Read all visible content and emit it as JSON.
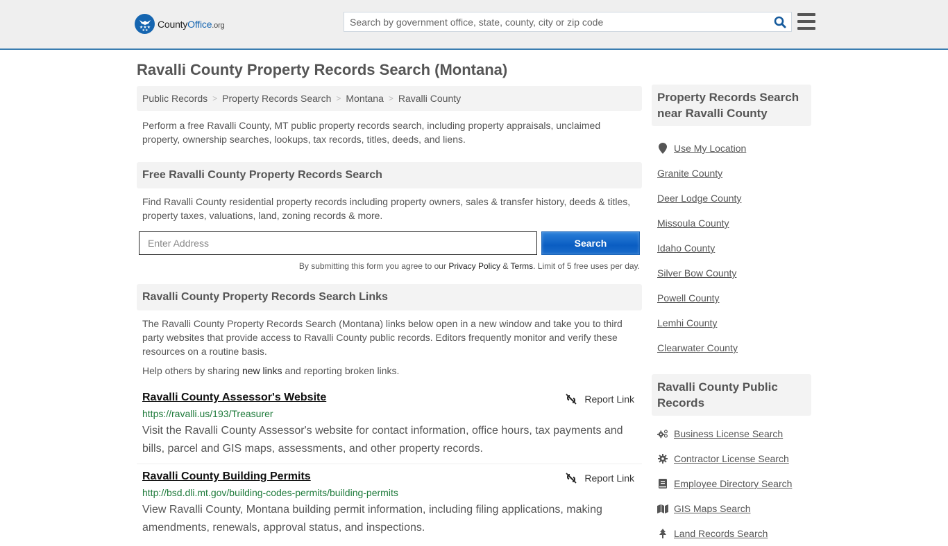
{
  "header": {
    "logo": {
      "county": "County",
      "office": "Office",
      "org": ".org"
    },
    "search_placeholder": "Search by government office, state, county, city or zip code",
    "brand_color": "#1565b0",
    "border_color": "#3a7db0"
  },
  "page_title": "Ravalli County Property Records Search (Montana)",
  "breadcrumb": [
    {
      "label": "Public Records"
    },
    {
      "label": "Property Records Search"
    },
    {
      "label": "Montana"
    },
    {
      "label": "Ravalli County"
    }
  ],
  "intro": "Perform a free Ravalli County, MT public property records search, including property appraisals, unclaimed property, ownership searches, lookups, tax records, titles, deeds, and liens.",
  "search_section": {
    "heading": "Free Ravalli County Property Records Search",
    "description": "Find Ravalli County residential property records including property owners, sales & transfer history, deeds & titles, property taxes, valuations, land, zoning records & more.",
    "address_placeholder": "Enter Address",
    "submit_label": "Search",
    "legal": {
      "prefix": "By submitting this form you agree to our ",
      "privacy": "Privacy Policy",
      "amp": " & ",
      "terms": "Terms",
      "suffix": ". Limit of 5 free uses per day."
    }
  },
  "links_section": {
    "heading": "Ravalli County Property Records Search Links",
    "description": "The Ravalli County Property Records Search (Montana) links below open in a new window and take you to third party websites that provide access to Ravalli County public records. Editors frequently monitor and verify these resources on a routine basis.",
    "help": {
      "prefix": "Help others by sharing ",
      "link": "new links",
      "suffix": " and reporting broken links."
    },
    "report_label": "Report Link",
    "items": [
      {
        "title": "Ravalli County Assessor's Website",
        "url": "https://ravalli.us/193/Treasurer",
        "body": "Visit the Ravalli County Assessor's website for contact information, office hours, tax payments and bills, parcel and GIS maps, assessments, and other property records."
      },
      {
        "title": "Ravalli County Building Permits",
        "url": "http://bsd.dli.mt.gov/building-codes-permits/building-permits",
        "body": "View Ravalli County, Montana building permit information, including filing applications, making amendments, renewals, approval status, and inspections."
      }
    ]
  },
  "sidebar": {
    "nearby_heading": "Property Records Search near Ravalli County",
    "use_location": "Use My Location",
    "nearby": [
      "Granite County",
      "Deer Lodge County",
      "Missoula County",
      "Idaho County",
      "Silver Bow County",
      "Powell County",
      "Lemhi County",
      "Clearwater County"
    ],
    "public_records_heading": "Ravalli County Public Records",
    "public_records": [
      {
        "label": "Business License Search",
        "icon": "cogs-icon"
      },
      {
        "label": "Contractor License Search",
        "icon": "gear-icon"
      },
      {
        "label": "Employee Directory Search",
        "icon": "book-icon"
      },
      {
        "label": "GIS Maps Search",
        "icon": "map-icon"
      },
      {
        "label": "Land Records Search",
        "icon": "tree-icon"
      }
    ]
  }
}
